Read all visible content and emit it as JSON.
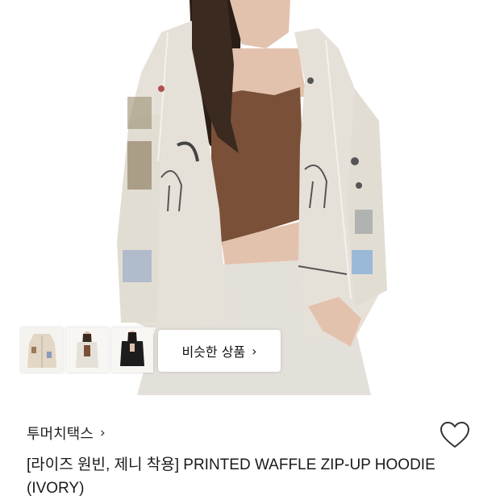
{
  "gallery": {
    "thumbnails": [
      {
        "icon": "hoodie-front-thumbnail"
      },
      {
        "icon": "hoodie-model-thumbnail"
      },
      {
        "icon": "leather-jacket-model-thumbnail"
      }
    ],
    "similar_label": "비슷한 상품",
    "similar_chevron": "›"
  },
  "product": {
    "brand": "투머치택스",
    "brand_chevron": "›",
    "title": "[라이즈 원빈, 제니 착용] PRINTED WAFFLE ZIP-UP HOODIE (IVORY)",
    "wishlist_icon": "heart-outline-icon"
  },
  "colors": {
    "hoodie": "#e6e1d8",
    "top": "#7a5038",
    "hair": "#2a1d16",
    "skin": "#e3c2ad",
    "pants": "#e3e0da",
    "heart_stroke": "#333333"
  }
}
